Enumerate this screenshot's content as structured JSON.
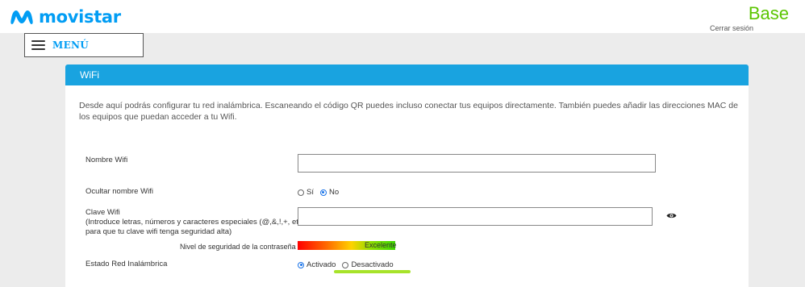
{
  "header": {
    "brand": "movistar",
    "product": "Base",
    "logout_label": "Cerrar sesión"
  },
  "menu": {
    "label": "MENÚ"
  },
  "panel": {
    "title": "WiFi",
    "intro": "Desde aquí podrás configurar tu red inalámbrica. Escaneando el código QR puedes incluso conectar tus equipos directamente. También puedes añadir las direcciones MAC de los equipos que puedan acceder a tu Wifi."
  },
  "form": {
    "wifi_name": {
      "label": "Nombre Wifi",
      "value": ""
    },
    "hide_name": {
      "label": "Ocultar nombre Wifi",
      "options": [
        "Sí",
        "No"
      ],
      "selected": "No"
    },
    "password": {
      "label_line1": "Clave Wifi",
      "label_line2": "(Introduce letras, números y caracteres especiales (@,&,!,+, etc)",
      "label_line3": "para que tu clave wifi tenga seguridad alta)",
      "value": "",
      "reveal_icon": "eye-icon"
    },
    "strength": {
      "label": "Nivel de seguridad de la contraseña",
      "value_text": "Excelente",
      "level": 1.0
    },
    "wireless_state": {
      "label": "Estado Red Inalámbrica",
      "options": [
        "Activado",
        "Desactivado"
      ],
      "selected": "Activado"
    }
  },
  "colors": {
    "brand_blue": "#019df4",
    "base_green": "#5bc500",
    "panel_header": "#19a3e0",
    "highlight_green": "#a7e32a"
  }
}
